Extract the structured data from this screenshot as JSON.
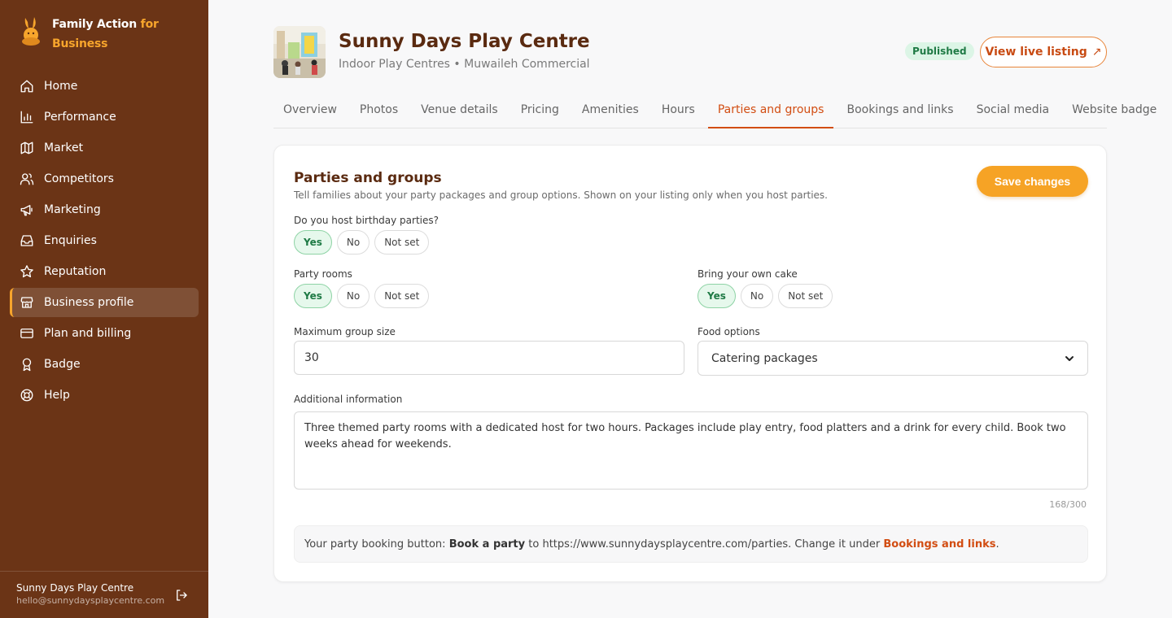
{
  "brand": {
    "name_part1": "Family Action ",
    "name_part2": "for",
    "name_part3": "Business"
  },
  "sidebar": {
    "items": [
      {
        "label": "Home",
        "icon": "home-icon"
      },
      {
        "label": "Performance",
        "icon": "bar-chart-icon"
      },
      {
        "label": "Market",
        "icon": "map-icon"
      },
      {
        "label": "Competitors",
        "icon": "users-icon"
      },
      {
        "label": "Marketing",
        "icon": "megaphone-icon"
      },
      {
        "label": "Enquiries",
        "icon": "inbox-icon"
      },
      {
        "label": "Reputation",
        "icon": "star-icon"
      },
      {
        "label": "Business profile",
        "icon": "store-icon",
        "active": true
      },
      {
        "label": "Plan and billing",
        "icon": "credit-card-icon"
      },
      {
        "label": "Badge",
        "icon": "award-icon"
      },
      {
        "label": "Help",
        "icon": "life-buoy-icon"
      }
    ],
    "footer": {
      "name": "Sunny Days Play Centre",
      "email": "hello@sunnydaysplaycentre.com"
    }
  },
  "header": {
    "title": "Sunny Days Play Centre",
    "subtitle": "Indoor Play Centres • Muwaileh Commercial",
    "status": "Published",
    "view_live": "View live listing",
    "view_live_arrow": "↗"
  },
  "tabs": [
    {
      "label": "Overview"
    },
    {
      "label": "Photos"
    },
    {
      "label": "Venue details"
    },
    {
      "label": "Pricing"
    },
    {
      "label": "Amenities"
    },
    {
      "label": "Hours"
    },
    {
      "label": "Parties and groups",
      "active": true
    },
    {
      "label": "Bookings and links"
    },
    {
      "label": "Social media"
    },
    {
      "label": "Website badge"
    }
  ],
  "card": {
    "title": "Parties and groups",
    "description": "Tell families about your party packages and group options. Shown on your listing only when you host parties.",
    "save": "Save changes",
    "birthday": {
      "label": "Do you host birthday parties?",
      "options": [
        "Yes",
        "No",
        "Not set"
      ],
      "selected": "Yes"
    },
    "party_rooms": {
      "label": "Party rooms",
      "options": [
        "Yes",
        "No",
        "Not set"
      ],
      "selected": "Yes"
    },
    "own_cake": {
      "label": "Bring your own cake",
      "options": [
        "Yes",
        "No",
        "Not set"
      ],
      "selected": "Yes"
    },
    "max_group": {
      "label": "Maximum group size",
      "value": "30"
    },
    "food": {
      "label": "Food options",
      "value": "Catering packages"
    },
    "additional": {
      "label": "Additional information",
      "value": "Three themed party rooms with a dedicated host for two hours. Packages include play entry, food platters and a drink for every child. Book two weeks ahead for weekends.",
      "count": "168/300"
    },
    "info": {
      "prefix": "Your party booking button: ",
      "button_name": "Book a party",
      "middle": " to https://www.sunnydaysplaycentre.com/parties. Change it under ",
      "link": "Bookings and links",
      "suffix": "."
    }
  },
  "colors": {
    "sidebar": "#6b3416",
    "accent": "#f6a325",
    "link": "#d24d12",
    "success": "#1f7a45"
  }
}
